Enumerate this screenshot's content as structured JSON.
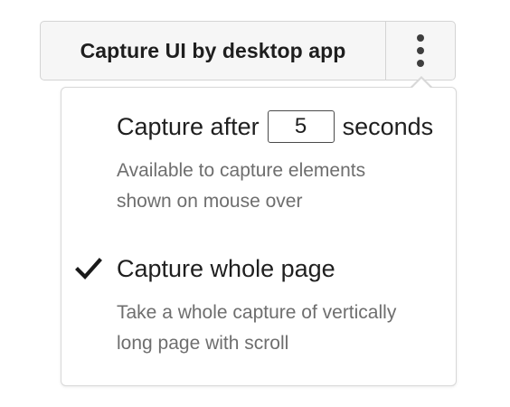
{
  "toolbar": {
    "capture_label": "Capture UI by desktop app",
    "menu_icon": "more-vertical-icon"
  },
  "menu": {
    "delay_option": {
      "prefix": "Capture after",
      "value": "5",
      "suffix": "seconds",
      "description_line1": "Available to capture elements",
      "description_line2": "shown on mouse over",
      "checked": false
    },
    "whole_page_option": {
      "label": "Capture whole page",
      "description_line1": "Take a whole capture of vertically",
      "description_line2": "long page with scroll",
      "checked": true,
      "check_icon": "checkmark-icon"
    }
  },
  "colors": {
    "button_bg": "#f6f6f6",
    "border": "#d4d4d4",
    "text": "#1f1f1f",
    "muted_text": "#6e6e6e"
  }
}
